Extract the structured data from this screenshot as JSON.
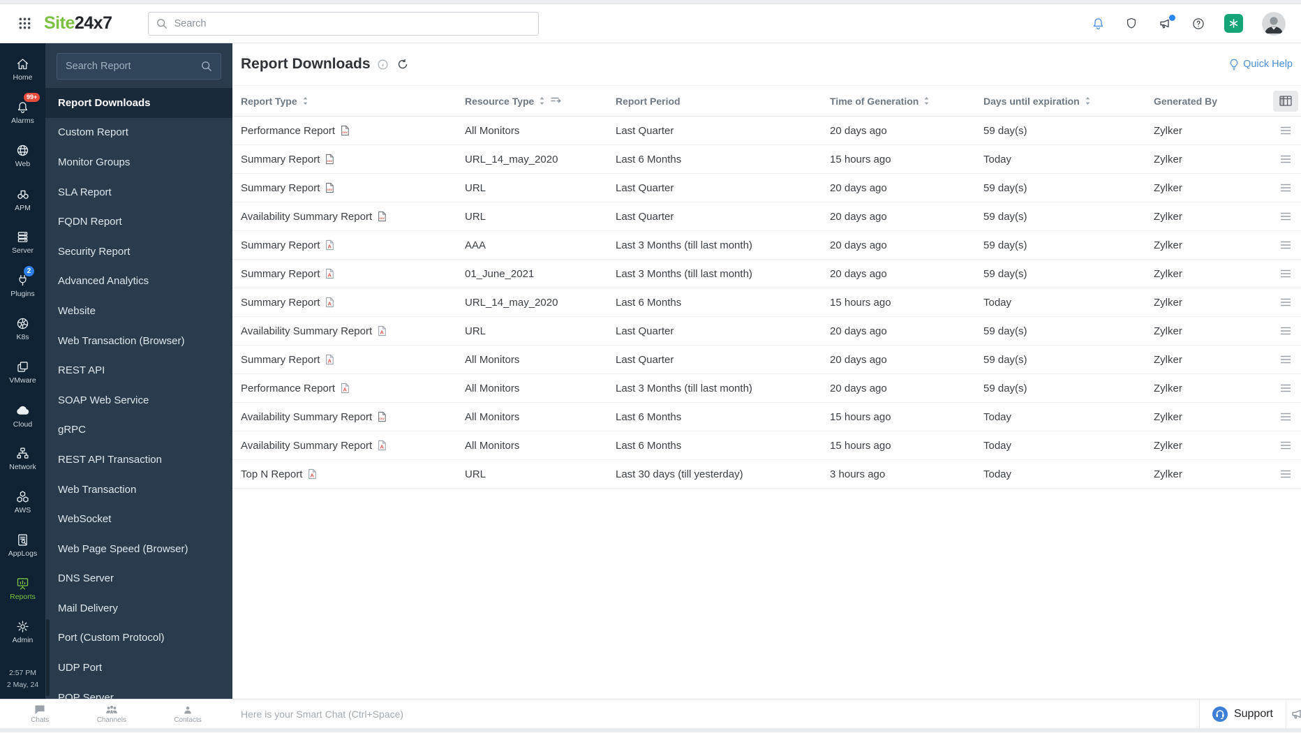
{
  "top_bar": {
    "app_launcher_icon": "grid-icon",
    "logo_text_green": "Site",
    "logo_text_dark": "24x7",
    "search_placeholder": "Search",
    "right_icons": [
      "notifications-bell-icon",
      "shield-icon",
      "announcements-megaphone-icon",
      "help-icon",
      "ai-assistant-icon",
      "user-avatar"
    ]
  },
  "left_rail": {
    "items": [
      {
        "label": "Home",
        "icon": "home-icon"
      },
      {
        "label": "Alarms",
        "icon": "alarms-bell-icon",
        "badge": "99+",
        "badge_style": "red"
      },
      {
        "label": "Web",
        "icon": "web-globe-icon"
      },
      {
        "label": "APM",
        "icon": "apm-binoculars-icon"
      },
      {
        "label": "Server",
        "icon": "server-icon"
      },
      {
        "label": "Plugins",
        "icon": "plugins-plug-icon",
        "badge": "2",
        "badge_style": "blue"
      },
      {
        "label": "K8s",
        "icon": "kubernetes-helm-icon"
      },
      {
        "label": "VMware",
        "icon": "vmware-layers-icon"
      },
      {
        "label": "Cloud",
        "icon": "cloud-icon"
      },
      {
        "label": "Network",
        "icon": "network-topology-icon"
      },
      {
        "label": "AWS",
        "icon": "aws-cubes-icon"
      },
      {
        "label": "AppLogs",
        "icon": "applogs-document-icon"
      },
      {
        "label": "Reports",
        "icon": "reports-presentation-icon",
        "active": true
      },
      {
        "label": "Admin",
        "icon": "admin-gear-icon"
      }
    ],
    "clock": {
      "time": "2:57 PM",
      "date": "2 May, 24"
    }
  },
  "report_nav": {
    "search_placeholder": "Search Report",
    "active_index": 0,
    "items": [
      "Report Downloads",
      "Custom Report",
      "Monitor Groups",
      "SLA Report",
      "FQDN Report",
      "Security Report",
      "Advanced Analytics",
      "Website",
      "Web Transaction (Browser)",
      "REST API",
      "SOAP Web Service",
      "gRPC",
      "REST API Transaction",
      "Web Transaction",
      "WebSocket",
      "Web Page Speed (Browser)",
      "DNS Server",
      "Mail Delivery",
      "Port (Custom Protocol)",
      "UDP Port",
      "POP Server"
    ]
  },
  "main": {
    "title": "Report Downloads",
    "title_icons": [
      "info-icon",
      "refresh-icon"
    ],
    "quick_help_label": "Quick Help",
    "table": {
      "columns": [
        {
          "label": "Report Type",
          "sortable": true,
          "filter": false
        },
        {
          "label": "Resource Type",
          "sortable": true,
          "filter": true
        },
        {
          "label": "Report Period",
          "sortable": false,
          "filter": false
        },
        {
          "label": "Time of Generation",
          "sortable": true,
          "filter": false
        },
        {
          "label": "Days until expiration",
          "sortable": true,
          "filter": false
        },
        {
          "label": "Generated By",
          "sortable": false,
          "filter": false
        }
      ],
      "rows": [
        {
          "report_type": "Performance Report",
          "format": "csv",
          "resource_type": "All Monitors",
          "report_period": "Last Quarter",
          "time_of_generation": "20 days ago",
          "days_until_expiration": "59 day(s)",
          "generated_by": "Zylker"
        },
        {
          "report_type": "Summary Report",
          "format": "csv",
          "resource_type": "URL_14_may_2020",
          "report_period": "Last 6 Months",
          "time_of_generation": "15 hours ago",
          "days_until_expiration": "Today",
          "generated_by": "Zylker"
        },
        {
          "report_type": "Summary Report",
          "format": "csv",
          "resource_type": "URL",
          "report_period": "Last Quarter",
          "time_of_generation": "20 days ago",
          "days_until_expiration": "59 day(s)",
          "generated_by": "Zylker"
        },
        {
          "report_type": "Availability Summary Report",
          "format": "csv",
          "resource_type": "URL",
          "report_period": "Last Quarter",
          "time_of_generation": "20 days ago",
          "days_until_expiration": "59 day(s)",
          "generated_by": "Zylker"
        },
        {
          "report_type": "Summary Report",
          "format": "pdf",
          "resource_type": "AAA",
          "report_period": "Last 3 Months (till last month)",
          "time_of_generation": "20 days ago",
          "days_until_expiration": "59 day(s)",
          "generated_by": "Zylker"
        },
        {
          "report_type": "Summary Report",
          "format": "pdf",
          "resource_type": "01_June_2021",
          "report_period": "Last 3 Months (till last month)",
          "time_of_generation": "20 days ago",
          "days_until_expiration": "59 day(s)",
          "generated_by": "Zylker"
        },
        {
          "report_type": "Summary Report",
          "format": "pdf",
          "resource_type": "URL_14_may_2020",
          "report_period": "Last 6 Months",
          "time_of_generation": "15 hours ago",
          "days_until_expiration": "Today",
          "generated_by": "Zylker"
        },
        {
          "report_type": "Availability Summary Report",
          "format": "pdf",
          "resource_type": "URL",
          "report_period": "Last Quarter",
          "time_of_generation": "20 days ago",
          "days_until_expiration": "59 day(s)",
          "generated_by": "Zylker"
        },
        {
          "report_type": "Summary Report",
          "format": "pdf",
          "resource_type": "All Monitors",
          "report_period": "Last Quarter",
          "time_of_generation": "20 days ago",
          "days_until_expiration": "59 day(s)",
          "generated_by": "Zylker"
        },
        {
          "report_type": "Performance Report",
          "format": "pdf",
          "resource_type": "All Monitors",
          "report_period": "Last 3 Months (till last month)",
          "time_of_generation": "20 days ago",
          "days_until_expiration": "59 day(s)",
          "generated_by": "Zylker"
        },
        {
          "report_type": "Availability Summary Report",
          "format": "csv",
          "resource_type": "All Monitors",
          "report_period": "Last 6 Months",
          "time_of_generation": "15 hours ago",
          "days_until_expiration": "Today",
          "generated_by": "Zylker"
        },
        {
          "report_type": "Availability Summary Report",
          "format": "pdf",
          "resource_type": "All Monitors",
          "report_period": "Last 6 Months",
          "time_of_generation": "15 hours ago",
          "days_until_expiration": "Today",
          "generated_by": "Zylker"
        },
        {
          "report_type": "Top N Report",
          "format": "pdf",
          "resource_type": "URL",
          "report_period": "Last 30 days (till yesterday)",
          "time_of_generation": "3 hours ago",
          "days_until_expiration": "Today",
          "generated_by": "Zylker"
        }
      ]
    }
  },
  "chat_bar": {
    "tabs": [
      {
        "label": "Chats",
        "icon": "chats-bubble-icon"
      },
      {
        "label": "Channels",
        "icon": "channels-people-icon"
      },
      {
        "label": "Contacts",
        "icon": "contacts-person-icon"
      }
    ],
    "input_placeholder": "Here is your Smart Chat (Ctrl+Space)",
    "support_label": "Support",
    "support_icon": "support-headset-icon",
    "edge_icon": "megaphone-icon"
  },
  "colors": {
    "brand_green": "#7cc142",
    "rail_bg": "#0f2233",
    "subnav_bg": "#2a3b4d",
    "accent_blue": "#4a8fd4",
    "bell_blue": "#4a90e2",
    "badge_red": "#e74c3c",
    "badge_blue": "#2f80ed",
    "ai_green": "#14a477",
    "support_blue": "#3d7fd6"
  }
}
